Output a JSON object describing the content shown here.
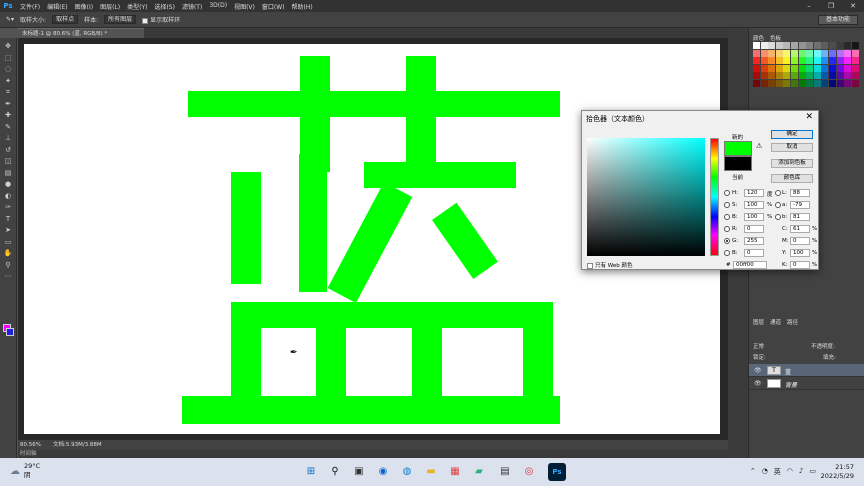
{
  "app": {
    "logo": "Ps",
    "menus": [
      "文件(F)",
      "编辑(E)",
      "图像(I)",
      "图层(L)",
      "类型(Y)",
      "选择(S)",
      "滤镜(T)",
      "3D(D)",
      "视图(V)",
      "窗口(W)",
      "帮助(H)"
    ]
  },
  "options": {
    "sample_size_label": "取样大小:",
    "sample_size_value": "取样点",
    "sample_label": "样本:",
    "sample_value": "所有图层",
    "show_ring_label": "显示取样环",
    "workspace": "基本功能"
  },
  "document": {
    "tab_title": "未标题-1 @ 80.6% (蓝, RGB/8) *",
    "zoom": "80.56%",
    "doc_info": "文档:5.93M/3.88M",
    "timeline": "时间轴",
    "glyph_color": "#00ff00"
  },
  "toolbar": {
    "fg_color": "#ff00ff",
    "bg_color": "#2020e0"
  },
  "right_panel": {
    "swatch_tabs": [
      "颜色",
      "色板"
    ],
    "layers_tabs": [
      "图层",
      "通道",
      "路径"
    ],
    "blend_mode": "正常",
    "opacity_label": "不透明度:",
    "lock_label": "锁定:",
    "fill_label": "填充:",
    "layers": [
      {
        "name": "蓝",
        "thumb": "T"
      },
      {
        "name": "背景",
        "thumb": ""
      }
    ]
  },
  "picker": {
    "title": "拾色器（文本颜色）",
    "new_label": "新的",
    "current_label": "当前",
    "new_color": "#00ff00",
    "current_color": "#000000",
    "buttons": {
      "ok": "确定",
      "cancel": "取消",
      "add_swatch": "添加到色板",
      "libraries": "颜色库"
    },
    "web_only": "只有 Web 颜色",
    "hsb": {
      "H": "120",
      "S": "100",
      "B": "100"
    },
    "hsb_units": {
      "H": "度",
      "S": "%",
      "B": "%"
    },
    "rgb": {
      "R": "0",
      "G": "255",
      "B": "0"
    },
    "lab": {
      "L": "88",
      "a": "-79",
      "b": "81"
    },
    "cmyk": {
      "C": "61",
      "M": "0",
      "Y": "100",
      "K": "0"
    },
    "hex": "00ff00"
  },
  "taskbar": {
    "temp": "29°C",
    "weather": "阴",
    "time": "21:57",
    "date": "2022/5/29",
    "ime": "英"
  }
}
